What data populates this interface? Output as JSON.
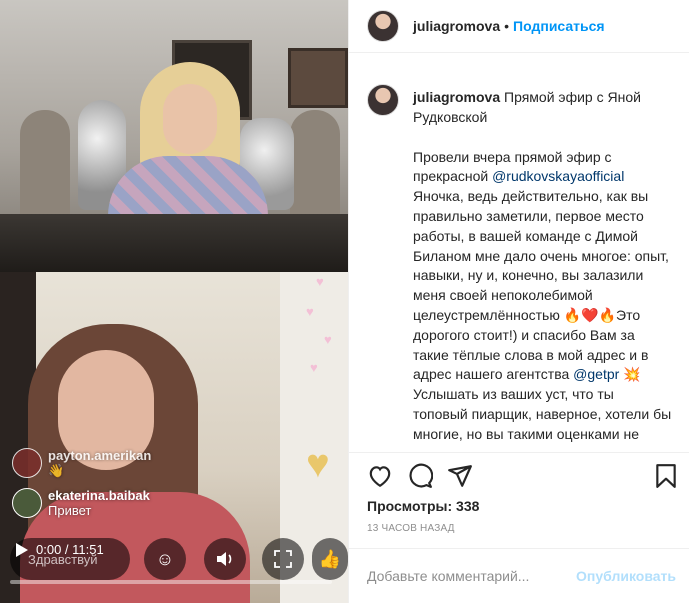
{
  "post": {
    "username": "juliagromova",
    "separator": "•",
    "follow_label": "Подписаться",
    "caption_title": "Прямой эфир с Яной Рудковской",
    "caption_pre_mention": "Провели вчера прямой эфир с прекрасной ",
    "mention_1": "@rudkovskayaofficial",
    "caption_mid": "\nЯночка, ведь действительно, как вы правильно заметили, первое место работы, в вашей команде с Димой Биланом мне дало очень многое: опыт, навыки, ну и, конечно, вы залазили меня своей непоколебимой целеустремлённостью 🔥❤️🔥Это дорогого стоит!) и спасибо Вам за такие тёплые слова в мой адрес и в адрес нашего агентства ",
    "mention_2": "@getpr",
    "caption_post_mention": " 💥\nУслышать из ваших уст, что ты топовый пиарщик, наверное, хотели бы многие, но вы такими оценками не разбрасываетесь 💞 Спасибо 🙏",
    "views_label": "Просмотры: 338",
    "time_ago": "13 часов назад",
    "comment_placeholder": "Добавьте комментарий...",
    "publish_label": "Опубликовать"
  },
  "video": {
    "comments": [
      {
        "user": "payton.amerikan",
        "text": "👋"
      },
      {
        "user": "ekaterina.baibak",
        "text": "Привет"
      }
    ],
    "say_hello_placeholder": "Здравствуй",
    "time_display": "0:00 / 11:51",
    "progress": 0.0,
    "reactions": [
      "laugh",
      "sound",
      "fullscreen",
      "praise"
    ]
  },
  "icons": {
    "like": "heart-outline-icon",
    "comment": "comment-bubble-icon",
    "share": "paper-plane-icon",
    "save": "bookmark-icon"
  },
  "colors": {
    "link": "#00376b",
    "follow": "#0095f6",
    "publish_disabled": "#b2dffc",
    "muted": "#8e8e8e"
  }
}
